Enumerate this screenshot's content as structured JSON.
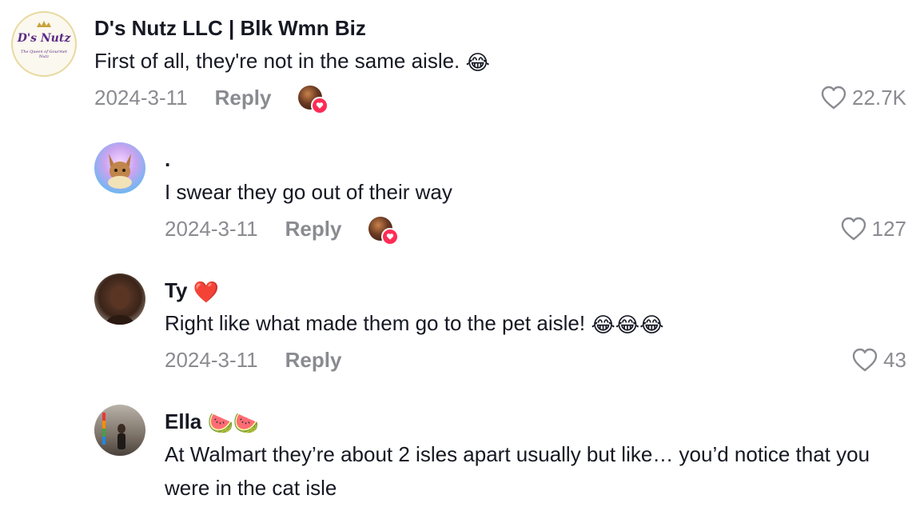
{
  "comments": [
    {
      "username": "D's Nutz LLC | Blk Wmn Biz",
      "avatar_text": "D's Nutz",
      "avatar_subtext": "The Queen of Gourmet Nutz",
      "text": "First of all, they're not in the same aisle.",
      "emoji": "😂",
      "date": "2024-3-11",
      "reply_label": "Reply",
      "likes": "22.7K",
      "creator_liked": true
    },
    {
      "username": ".",
      "text": "I swear they go out of their way",
      "date": "2024-3-11",
      "reply_label": "Reply",
      "likes": "127",
      "creator_liked": true
    },
    {
      "username": "Ty",
      "username_emoji": "❤️",
      "text": "Right like what made them go to the pet aisle!",
      "emoji": "😂😂😂",
      "date": "2024-3-11",
      "reply_label": "Reply",
      "likes": "43",
      "creator_liked": false
    },
    {
      "username": "Ella",
      "username_emoji": "🍉🍉",
      "text": "At Walmart they’re about 2 isles apart usually but like… you’d notice that you were in the cat isle"
    }
  ],
  "colors": {
    "text": "#161823",
    "secondary": "#8a8b91",
    "heart_badge": "#fe2c55"
  }
}
